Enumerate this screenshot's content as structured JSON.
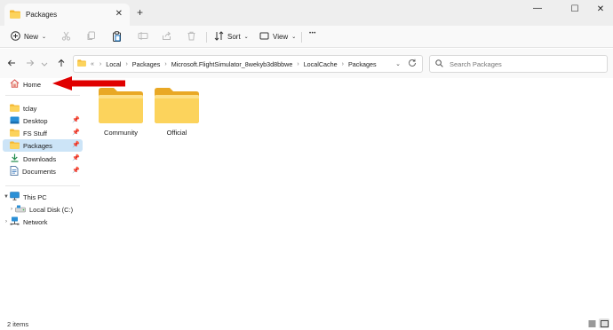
{
  "window": {
    "tab_title": "Packages",
    "new_tab_symbol": "+",
    "close_tab_symbol": "✕",
    "minimize_symbol": "—",
    "maximize_symbol": "☐",
    "close_symbol": "✕"
  },
  "toolbar": {
    "new_label": "New",
    "sort_label": "Sort",
    "view_label": "View",
    "more_symbol": "•••"
  },
  "address": {
    "breadcrumbs": [
      "Local",
      "Packages",
      "Microsoft.FlightSimulator_8wekyb3d8bbwe",
      "LocalCache",
      "Packages"
    ],
    "overflow_symbol": "«"
  },
  "search": {
    "placeholder": "Search Packages"
  },
  "sidebar": {
    "home": "Home",
    "quick_access": [
      {
        "label": "tclay",
        "icon": "folder-icon"
      },
      {
        "label": "Desktop",
        "icon": "desktop-icon"
      },
      {
        "label": "FS Stuff",
        "icon": "folder-icon"
      },
      {
        "label": "Packages",
        "icon": "folder-icon"
      },
      {
        "label": "Downloads",
        "icon": "download-icon"
      },
      {
        "label": "Documents",
        "icon": "document-icon"
      }
    ],
    "this_pc": "This PC",
    "local_disk": "Local Disk (C:)",
    "network": "Network"
  },
  "content": {
    "items": [
      {
        "name": "Community",
        "icon": "folder-icon"
      },
      {
        "name": "Official",
        "icon": "folder-icon"
      }
    ]
  },
  "status": {
    "item_count": "2 items"
  },
  "colors": {
    "selection": "#cce4f7",
    "folder_yellow": "#f8c94a",
    "accent_blue": "#0f6cbd",
    "annotation_red": "#e00000"
  }
}
